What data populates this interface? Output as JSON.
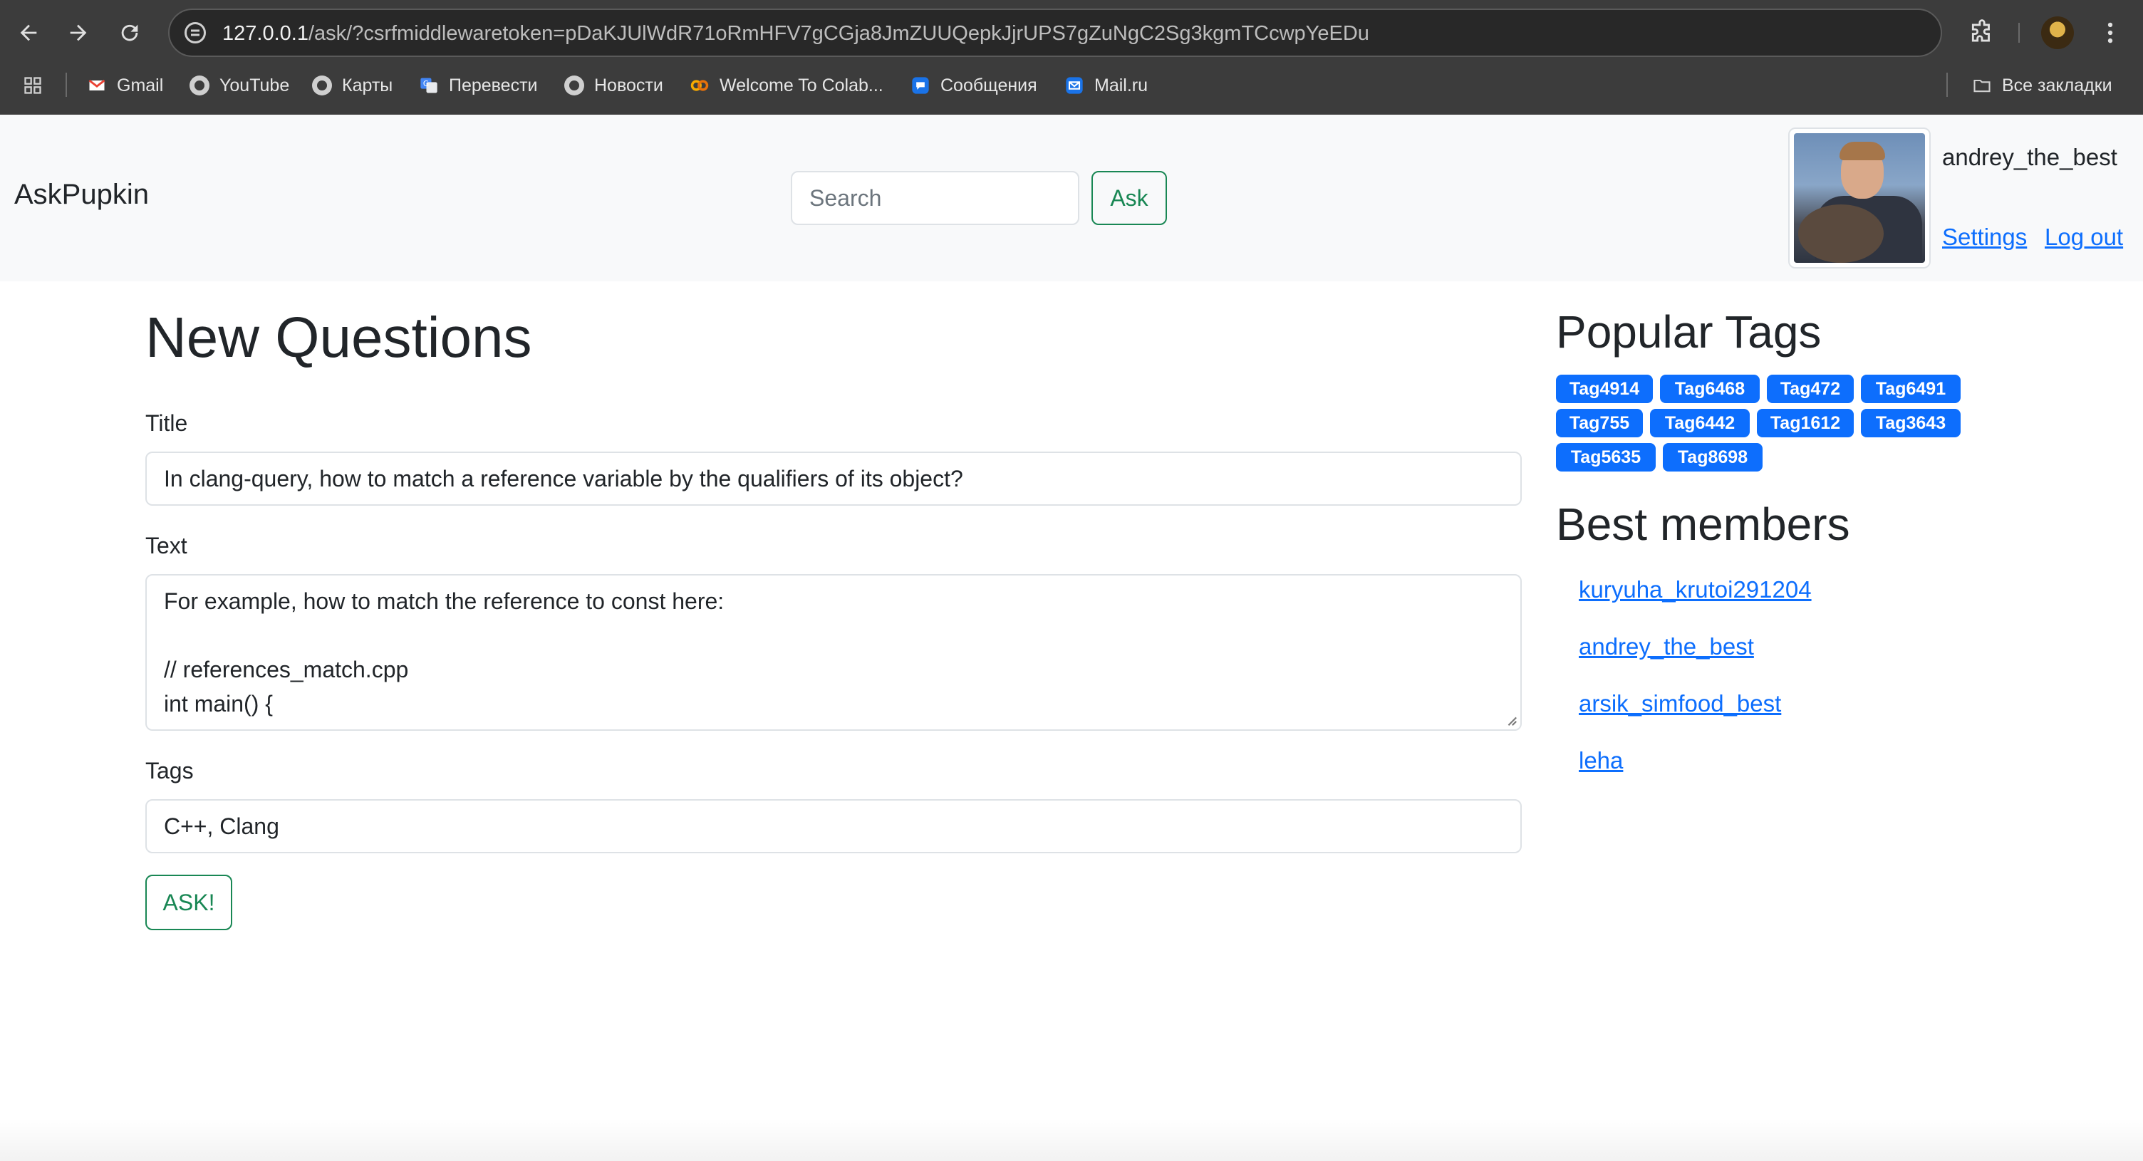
{
  "browser": {
    "url_host": "127.0.0.1",
    "url_path": "/ask/?csrfmiddlewaretoken=pDaKJUlWdR71oRmHFV7gCGja8JmZUUQepkJjrUPS7gZuNgC2Sg3kgmTCcwpYeEDu",
    "bookmarks": [
      {
        "label": "Gmail",
        "icon": "gmail-icon"
      },
      {
        "label": "YouTube",
        "icon": "globe-icon"
      },
      {
        "label": "Карты",
        "icon": "globe-icon"
      },
      {
        "label": "Перевести",
        "icon": "translate-icon"
      },
      {
        "label": "Новости",
        "icon": "globe-icon"
      },
      {
        "label": "Welcome To Colab...",
        "icon": "colab-icon"
      },
      {
        "label": "Сообщения",
        "icon": "messages-icon"
      },
      {
        "label": "Mail.ru",
        "icon": "mail-icon"
      }
    ],
    "all_bookmarks_label": "Все закладки"
  },
  "header": {
    "brand": "AskPupkin",
    "search_placeholder": "Search",
    "ask_button": "Ask",
    "username": "andrey_the_best",
    "settings_link": "Settings",
    "logout_link": "Log out"
  },
  "form": {
    "page_title": "New Questions",
    "title_label": "Title",
    "title_value": "In clang-query, how to match a reference variable by the qualifiers of its object?",
    "text_label": "Text",
    "text_lines": [
      "For example, how to match the reference to const here:",
      "",
      "// references_match.cpp",
      "int main() {"
    ],
    "tags_label": "Tags",
    "tags_value": "C++, Clang",
    "submit_button": "ASK!"
  },
  "sidebar": {
    "popular_tags_title": "Popular Tags",
    "tags": [
      "Tag4914",
      "Tag6468",
      "Tag472",
      "Tag6491",
      "Tag755",
      "Tag6442",
      "Tag1612",
      "Tag3643",
      "Tag5635",
      "Tag8698"
    ],
    "best_members_title": "Best members",
    "members": [
      "kuryuha_krutoi291204",
      "andrey_the_best",
      "arsik_simfood_best",
      "leha"
    ]
  },
  "colors": {
    "primary": "#0d6efd",
    "success": "#198754",
    "header_bg": "#f8f9fa",
    "chrome_bg": "#3c3c3c"
  }
}
